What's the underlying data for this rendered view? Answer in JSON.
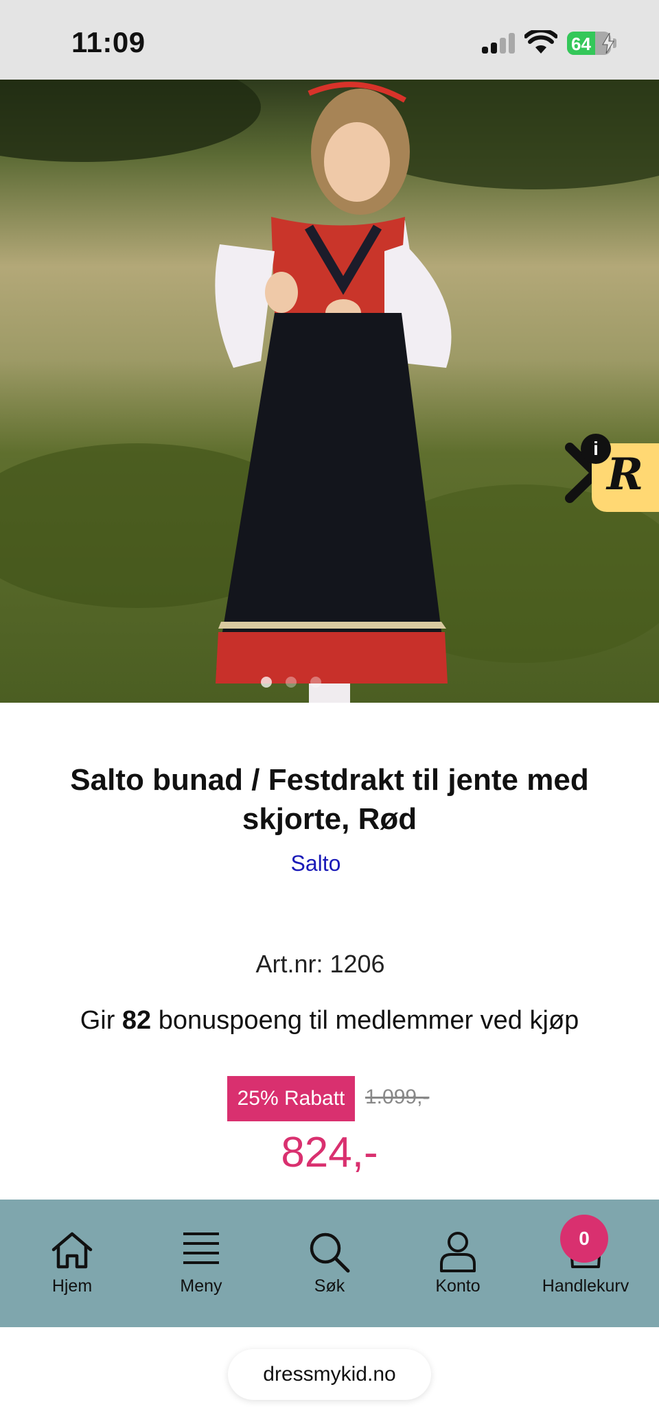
{
  "status_bar": {
    "time": "11:09",
    "battery_percent": "64",
    "battery_level": 0.64,
    "charging": true
  },
  "carousel": {
    "image_count": 3,
    "active_index": 0,
    "next_icon": "chevron-right-icon"
  },
  "review_widget": {
    "letter": "R",
    "info_glyph": "i",
    "color": "#ffd873"
  },
  "product": {
    "title": "Salto bunad / Festdrakt til jente med skjorte, Rød",
    "brand": "Salto",
    "art_nr": "Art.nr: 1206",
    "bonus_prefix": "Gir ",
    "bonus_points": "82",
    "bonus_suffix": " bonuspoeng til medlemmer ved kjøp",
    "discount_label": "25% Rabatt",
    "old_price": "1.099,-",
    "price": "824,-"
  },
  "bottom_nav": {
    "items": [
      {
        "label": "Hjem",
        "icon": "home-icon"
      },
      {
        "label": "Meny",
        "icon": "menu-icon"
      },
      {
        "label": "Søk",
        "icon": "search-icon"
      },
      {
        "label": "Konto",
        "icon": "user-icon"
      },
      {
        "label": "Handlekurv",
        "icon": "cart-icon"
      }
    ],
    "cart_count": "0",
    "background": "#7fa6ad"
  },
  "browser": {
    "url": "dressmykid.no"
  },
  "colors": {
    "accent": "#d9306f",
    "link": "#1a1ab8"
  }
}
